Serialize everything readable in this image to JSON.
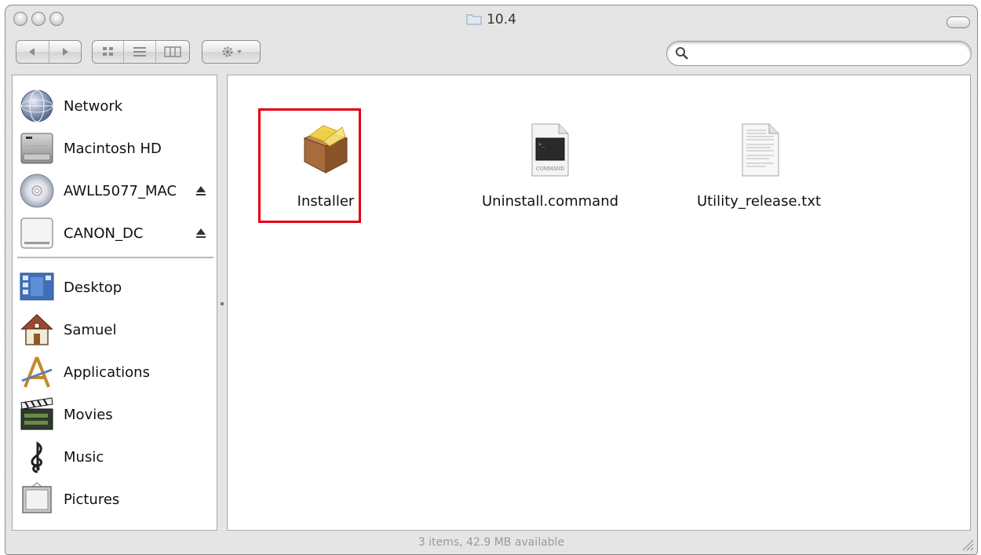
{
  "window": {
    "title": "10.4",
    "status": "3 items, 42.9 MB available"
  },
  "toolbar": {
    "back_label": "◀",
    "forward_label": "▶",
    "view_icon": "icon-view-icon",
    "view_list": "list-view-icon",
    "view_column": "column-view-icon",
    "action_icon": "gear-icon",
    "search_placeholder": ""
  },
  "sidebar": {
    "devices": [
      {
        "label": "Network",
        "icon": "network-globe-icon",
        "eject": false
      },
      {
        "label": "Macintosh HD",
        "icon": "hard-drive-icon",
        "eject": false
      },
      {
        "label": "AWLL5077_MAC",
        "icon": "cd-disc-icon",
        "eject": true
      },
      {
        "label": "CANON_DC",
        "icon": "removable-drive-icon",
        "eject": true
      }
    ],
    "places": [
      {
        "label": "Desktop",
        "icon": "desktop-icon"
      },
      {
        "label": "Samuel",
        "icon": "home-icon"
      },
      {
        "label": "Applications",
        "icon": "applications-icon"
      },
      {
        "label": "Movies",
        "icon": "movies-icon"
      },
      {
        "label": "Music",
        "icon": "music-icon"
      },
      {
        "label": "Pictures",
        "icon": "pictures-icon"
      }
    ]
  },
  "files": [
    {
      "name": "Installer",
      "icon": "package-icon",
      "highlighted": true
    },
    {
      "name": "Uninstall.command",
      "icon": "command-file-icon",
      "badge": "COMMAND"
    },
    {
      "name": "Utility_release.txt",
      "icon": "text-file-icon"
    }
  ],
  "colors": {
    "highlight_border": "#e3000e"
  }
}
